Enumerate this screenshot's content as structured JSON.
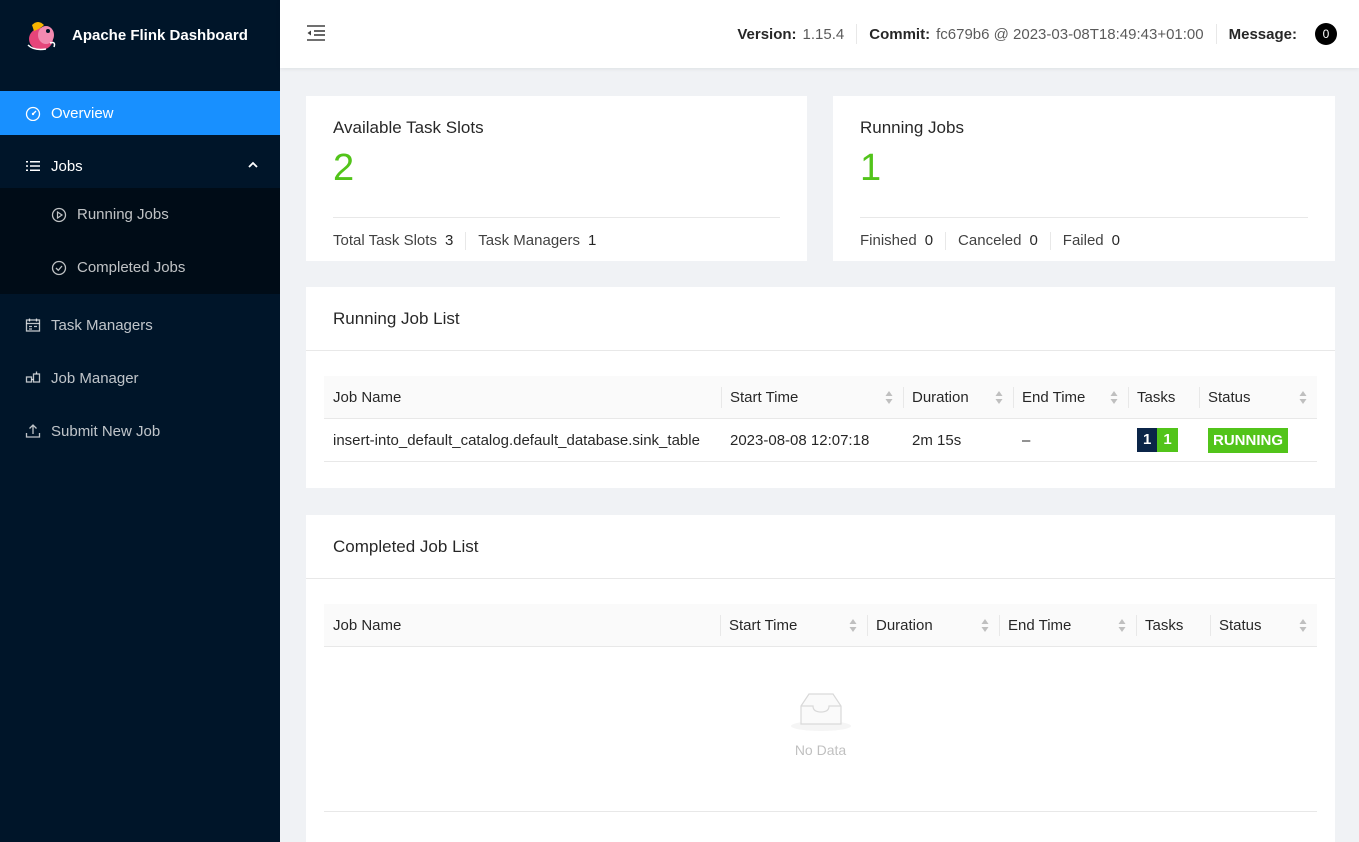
{
  "brand": {
    "title": "Apache Flink Dashboard"
  },
  "menu": {
    "overview": "Overview",
    "jobs": "Jobs",
    "running_jobs": "Running Jobs",
    "completed_jobs": "Completed Jobs",
    "task_managers": "Task Managers",
    "job_manager": "Job Manager",
    "submit_new_job": "Submit New Job"
  },
  "header": {
    "version_label": "Version:",
    "version_value": "1.15.4",
    "commit_label": "Commit:",
    "commit_value": "fc679b6 @ 2023-03-08T18:49:43+01:00",
    "message_label": "Message:",
    "message_count": "0"
  },
  "slots_card": {
    "title": "Available Task Slots",
    "value": "2",
    "total_label": "Total Task Slots",
    "total_value": "3",
    "tm_label": "Task Managers",
    "tm_value": "1"
  },
  "jobs_card": {
    "title": "Running Jobs",
    "value": "1",
    "finished_label": "Finished",
    "finished_value": "0",
    "canceled_label": "Canceled",
    "canceled_value": "0",
    "failed_label": "Failed",
    "failed_value": "0"
  },
  "running_list": {
    "title": "Running Job List",
    "columns": [
      "Job Name",
      "Start Time",
      "Duration",
      "End Time",
      "Tasks",
      "Status"
    ],
    "rows": [
      {
        "job_name": "insert-into_default_catalog.default_database.sink_table",
        "start_time": "2023-08-08 12:07:18",
        "duration": "2m 15s",
        "end_time": "–",
        "tasks_total": "1",
        "tasks_running": "1",
        "status": "RUNNING"
      }
    ]
  },
  "completed_list": {
    "title": "Completed Job List",
    "columns": [
      "Job Name",
      "Start Time",
      "Duration",
      "End Time",
      "Tasks",
      "Status"
    ],
    "empty_text": "No Data"
  },
  "colors": {
    "sidebar": "#001529",
    "active": "#1890ff",
    "green": "#52c41a",
    "tag_dark": "#0b2548"
  }
}
